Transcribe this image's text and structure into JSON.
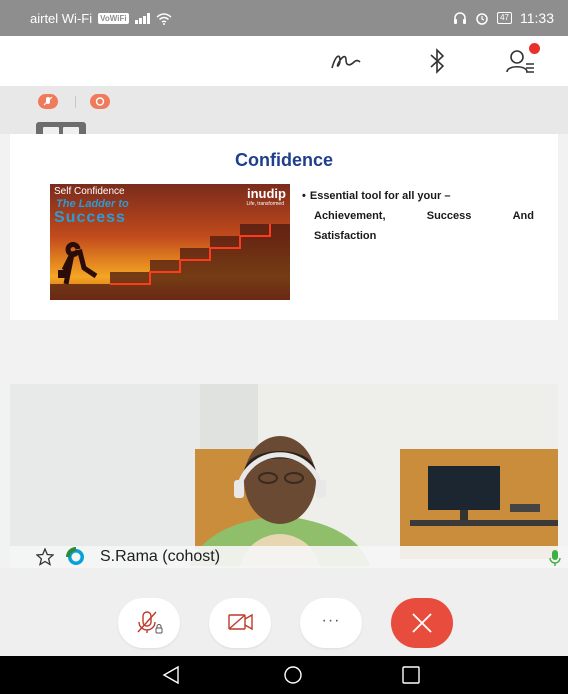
{
  "status_bar": {
    "carrier": "airtel Wi-Fi",
    "volte_badge": "VoWiFi",
    "battery": "47",
    "time": "11:33"
  },
  "slide": {
    "title": "Confidence",
    "image": {
      "heading": "Self Confidence",
      "subheading1": "The Ladder to",
      "subheading2": "Success",
      "logo": "inudip",
      "logo_tagline": "Life, transformed"
    },
    "bullet_line1": "Essential tool for all your –",
    "bullet_line2_words": [
      "Achievement,",
      "Success",
      "And"
    ],
    "bullet_line3": "Satisfaction"
  },
  "participant": {
    "name": "S.Rama (cohost)"
  },
  "controls": {
    "more_label": "···"
  },
  "colors": {
    "status_bar_bg": "#8e8e8e",
    "accent_red": "#e84c3d",
    "slide_title": "#1f3f8c",
    "indicator_orange": "#f07b5c",
    "mic_green": "#3cb043"
  }
}
